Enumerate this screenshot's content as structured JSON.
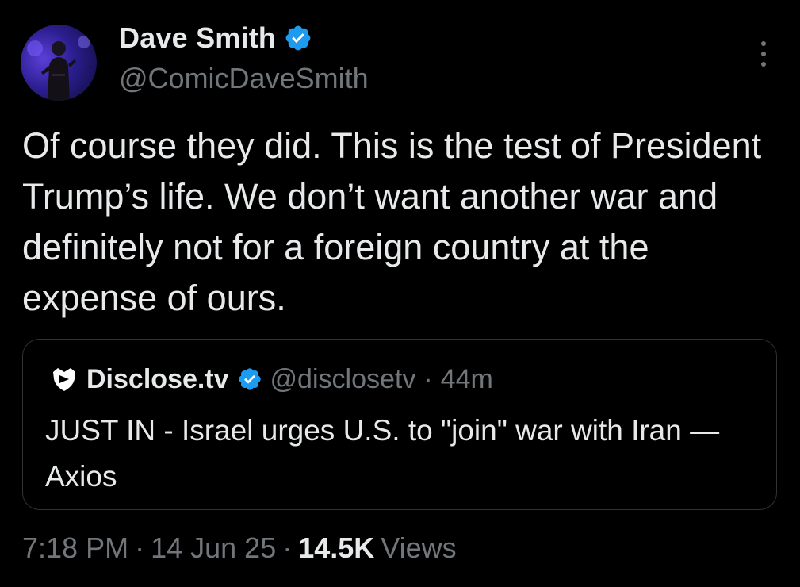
{
  "author": {
    "display_name": "Dave Smith",
    "handle": "@ComicDaveSmith",
    "verified": true
  },
  "tweet": {
    "text": "Of course they did. This is the test of President Trump’s life. We don’t want another war and definitely not for a foreign country at the expense of ours."
  },
  "quoted_tweet": {
    "display_name": "Disclose.tv",
    "handle": "@disclosetv",
    "separator": "·",
    "time": "44m",
    "verified": true,
    "text": "JUST IN - Israel urges U.S. to \"join\" war with Iran — Axios"
  },
  "meta": {
    "time": "7:18 PM",
    "sep1": "·",
    "date": "14 Jun 25",
    "sep2": "·",
    "views_count": "14.5K",
    "views_label": "Views"
  },
  "colors": {
    "background": "#000000",
    "text_primary": "#e7e9ea",
    "text_secondary": "#71767b",
    "verified_blue": "#1d9bf0",
    "border": "#2f3336"
  },
  "icons": {
    "verified": "verified-badge-icon",
    "more": "more-options-icon",
    "quote_logo": "disclosetv-logo-icon"
  }
}
